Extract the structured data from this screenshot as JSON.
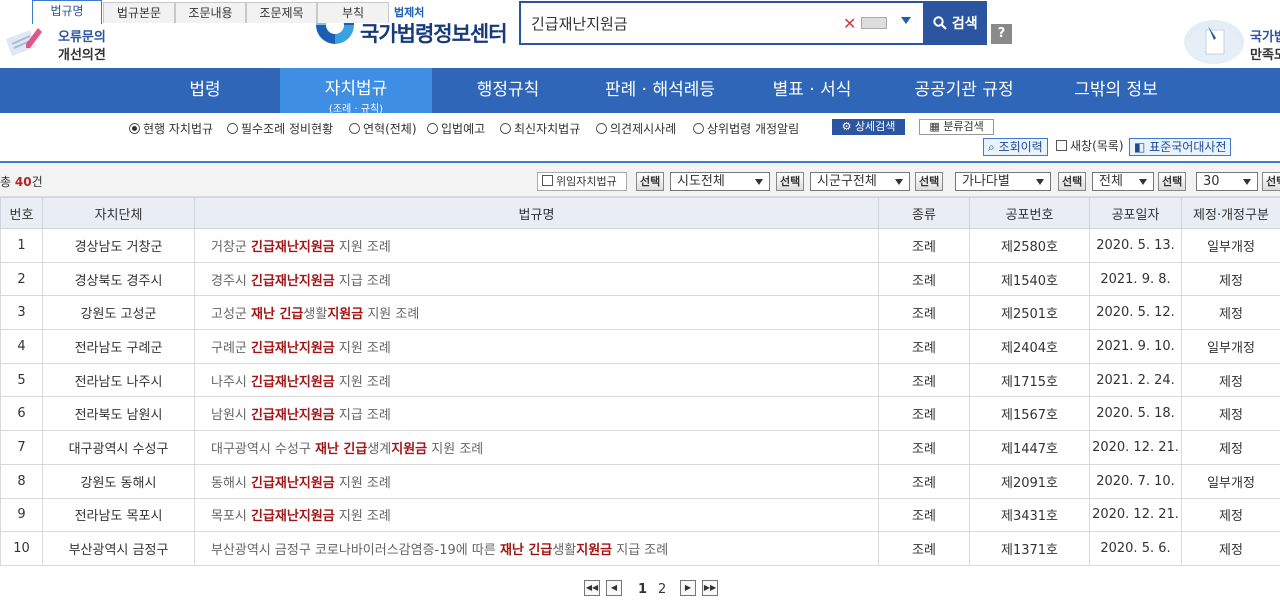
{
  "header": {
    "error_report": {
      "line1": "오류문의",
      "line2": "개선의견"
    },
    "logo": {
      "sub": "법제처",
      "main": "국가법령정보센터"
    },
    "search": {
      "value": "긴급재난지원금",
      "button": "검색",
      "help": "?"
    },
    "satisfaction": {
      "line1": "국가법",
      "line2": "만족도"
    }
  },
  "nav": {
    "items": [
      {
        "label": "법령"
      },
      {
        "label": "자치법규",
        "sub": "(조례 · 규칙)"
      },
      {
        "label": "행정규칙"
      },
      {
        "label": "판례 · 해석례등"
      },
      {
        "label": "별표 · 서식"
      },
      {
        "label": "공공기관 규정"
      },
      {
        "label": "그밖의 정보"
      }
    ]
  },
  "filters": {
    "radios": [
      "현행 자치법규",
      "필수조례 정비현황",
      "연혁(전체)",
      "입법예고",
      "최신자치법규",
      "의견제시사례",
      "상위법령 개정알림"
    ],
    "advanced": "상세검색",
    "category": "분류검색"
  },
  "tabs": [
    "법규명",
    "법규본문",
    "조문내용",
    "조문제목",
    "부칙"
  ],
  "tools": {
    "history": "조회이력",
    "newwin": "새창(목록)",
    "dict": "표준국어대사전"
  },
  "listbar": {
    "total_prefix": "총",
    "total_count": "40",
    "total_suffix": "건",
    "violation": "위임자치법규",
    "pick": "선택",
    "sido": "시도전체",
    "sigungu": "시군구전체",
    "sort": "가나다별",
    "type": "전체",
    "page_size": "30"
  },
  "table": {
    "headers": [
      "번호",
      "자치단체",
      "법규명",
      "종류",
      "공포번호",
      "공포일자",
      "제정·개정구분"
    ],
    "rows": [
      {
        "no": "1",
        "org": "경상남도 거창군",
        "name": [
          [
            "거창군 ",
            ""
          ],
          [
            "긴급재난지원금",
            "hl"
          ],
          [
            " 지원 조례",
            ""
          ]
        ],
        "kind": "조례",
        "pnum": "제2580호",
        "date": "2020. 5. 13.",
        "rev": "일부개정"
      },
      {
        "no": "2",
        "org": "경상북도 경주시",
        "name": [
          [
            "경주시 ",
            ""
          ],
          [
            "긴급재난지원금",
            "hl"
          ],
          [
            " 지급 조례",
            ""
          ]
        ],
        "kind": "조례",
        "pnum": "제1540호",
        "date": "2021. 9. 8.",
        "rev": "제정"
      },
      {
        "no": "3",
        "org": "강원도 고성군",
        "name": [
          [
            "고성군 ",
            ""
          ],
          [
            "재난 긴급",
            "hl"
          ],
          [
            "생활",
            ""
          ],
          [
            "지원금",
            "hl"
          ],
          [
            " 지원 조례",
            ""
          ]
        ],
        "kind": "조례",
        "pnum": "제2501호",
        "date": "2020. 5. 12.",
        "rev": "제정"
      },
      {
        "no": "4",
        "org": "전라남도 구례군",
        "name": [
          [
            "구례군 ",
            ""
          ],
          [
            "긴급재난지원금",
            "hl"
          ],
          [
            " 지원 조례",
            ""
          ]
        ],
        "kind": "조례",
        "pnum": "제2404호",
        "date": "2021. 9. 10.",
        "rev": "일부개정"
      },
      {
        "no": "5",
        "org": "전라남도 나주시",
        "name": [
          [
            "나주시 ",
            ""
          ],
          [
            "긴급재난지원금",
            "hl"
          ],
          [
            " 지원 조례",
            ""
          ]
        ],
        "kind": "조례",
        "pnum": "제1715호",
        "date": "2021. 2. 24.",
        "rev": "제정"
      },
      {
        "no": "6",
        "org": "전라북도 남원시",
        "name": [
          [
            "남원시 ",
            ""
          ],
          [
            "긴급재난지원금",
            "hl"
          ],
          [
            " 지급 조례",
            ""
          ]
        ],
        "kind": "조례",
        "pnum": "제1567호",
        "date": "2020. 5. 18.",
        "rev": "제정"
      },
      {
        "no": "7",
        "org": "대구광역시 수성구",
        "name": [
          [
            "대구광역시 수성구 ",
            ""
          ],
          [
            "재난 긴급",
            "hl"
          ],
          [
            "생계",
            ""
          ],
          [
            "지원금",
            "hl"
          ],
          [
            " 지원 조례",
            ""
          ]
        ],
        "kind": "조례",
        "pnum": "제1447호",
        "date": "2020. 12. 21.",
        "rev": "제정"
      },
      {
        "no": "8",
        "org": "강원도 동해시",
        "name": [
          [
            "동해시 ",
            ""
          ],
          [
            "긴급재난지원금",
            "hl"
          ],
          [
            " 지원 조례",
            ""
          ]
        ],
        "kind": "조례",
        "pnum": "제2091호",
        "date": "2020. 7. 10.",
        "rev": "일부개정"
      },
      {
        "no": "9",
        "org": "전라남도 목포시",
        "name": [
          [
            "목포시 ",
            ""
          ],
          [
            "긴급재난지원금",
            "hl"
          ],
          [
            " 지원 조례",
            ""
          ]
        ],
        "kind": "조례",
        "pnum": "제3431호",
        "date": "2020. 12. 21.",
        "rev": "제정"
      },
      {
        "no": "10",
        "org": "부산광역시 금정구",
        "name": [
          [
            "부산광역시 금정구 코로나바이러스감염증-19에 따른 ",
            ""
          ],
          [
            "재난 긴급",
            "hl"
          ],
          [
            "생활",
            ""
          ],
          [
            "지원금",
            "hl"
          ],
          [
            " 지급 조례",
            ""
          ]
        ],
        "kind": "조례",
        "pnum": "제1371호",
        "date": "2020. 5. 6.",
        "rev": "제정"
      }
    ]
  },
  "pagination": {
    "first": "◀◀",
    "prev": "◀",
    "pages": [
      "1",
      "2"
    ],
    "next": "▶",
    "last": "▶▶"
  },
  "colors": {
    "nav": "#2f66b8",
    "nav_active": "#3e8ee3",
    "highlight": "#a31515"
  }
}
